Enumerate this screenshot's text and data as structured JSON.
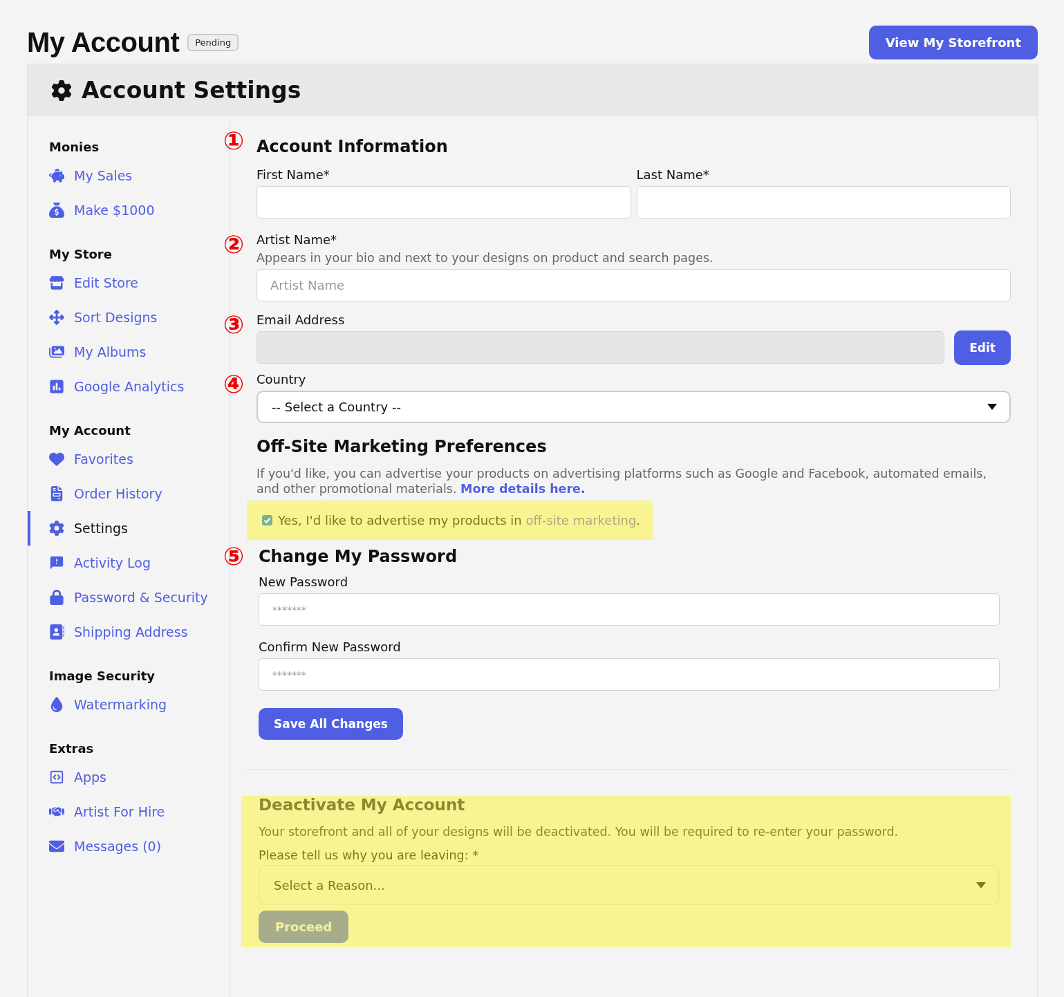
{
  "page": {
    "title": "My Account",
    "badge": "Pending",
    "storefront_button": "View My Storefront"
  },
  "panel_title": "Account Settings",
  "sidebar": [
    {
      "heading": "Monies",
      "items": [
        {
          "label": "My Sales",
          "selected": false
        },
        {
          "label": "Make $1000",
          "selected": false
        }
      ]
    },
    {
      "heading": "My Store",
      "items": [
        {
          "label": "Edit Store",
          "selected": false
        },
        {
          "label": "Sort Designs",
          "selected": false
        },
        {
          "label": "My Albums",
          "selected": false
        },
        {
          "label": "Google Analytics",
          "selected": false
        }
      ]
    },
    {
      "heading": "My Account",
      "items": [
        {
          "label": "Favorites",
          "selected": false
        },
        {
          "label": "Order History",
          "selected": false
        },
        {
          "label": "Settings",
          "selected": true
        },
        {
          "label": "Activity Log",
          "selected": false
        },
        {
          "label": "Password & Security",
          "selected": false
        },
        {
          "label": "Shipping Address",
          "selected": false
        }
      ]
    },
    {
      "heading": "Image Security",
      "items": [
        {
          "label": "Watermarking",
          "selected": false
        }
      ]
    },
    {
      "heading": "Extras",
      "items": [
        {
          "label": "Apps",
          "selected": false
        },
        {
          "label": "Artist For Hire",
          "selected": false
        },
        {
          "label": "Messages (0)",
          "selected": false
        }
      ]
    }
  ],
  "account_info": {
    "marker": "①",
    "heading": "Account Information",
    "fields": [
      {
        "label": "First Name*"
      },
      {
        "label": "Last Name*"
      }
    ]
  },
  "artist_name": {
    "marker": "②",
    "label": "Artist Name*",
    "help": "Appears in your bio and next to your designs on product and search pages.",
    "placeholder": "Artist Name"
  },
  "email": {
    "marker": "③",
    "label": "Email Address",
    "disabled": true,
    "button": "Edit"
  },
  "country": {
    "marker": "④",
    "label": "Country",
    "value": "-- Select a Country --"
  },
  "marketing": {
    "heading": "Off-Site Marketing Preferences",
    "text": "If you'd like, you can advertise your products on advertising platforms such as Google and Facebook, automated emails, and other promotional materials.",
    "link": "More details here.",
    "highlighted": true,
    "checked": true,
    "checkbox_text": "Yes, I'd like to advertise my products in",
    "checkbox_link": "off-site marketing",
    "checkbox_suffix": "."
  },
  "password": {
    "marker": "⑤",
    "heading": "Change My Password",
    "fields": [
      {
        "label": "New Password",
        "placeholder": "*******"
      },
      {
        "label": "Confirm New Password",
        "placeholder": "*******"
      }
    ],
    "button": "Save All Changes"
  },
  "deactivate": {
    "heading": "Deactivate My Account",
    "highlighted": true,
    "text": "Your storefront and all of your designs will be deactivated. You will be required to re-enter your password.",
    "reason_label": "Please tell us why you are leaving: *",
    "reason_value": "Select a Reason...",
    "button": "Proceed",
    "button_disabled": true
  }
}
